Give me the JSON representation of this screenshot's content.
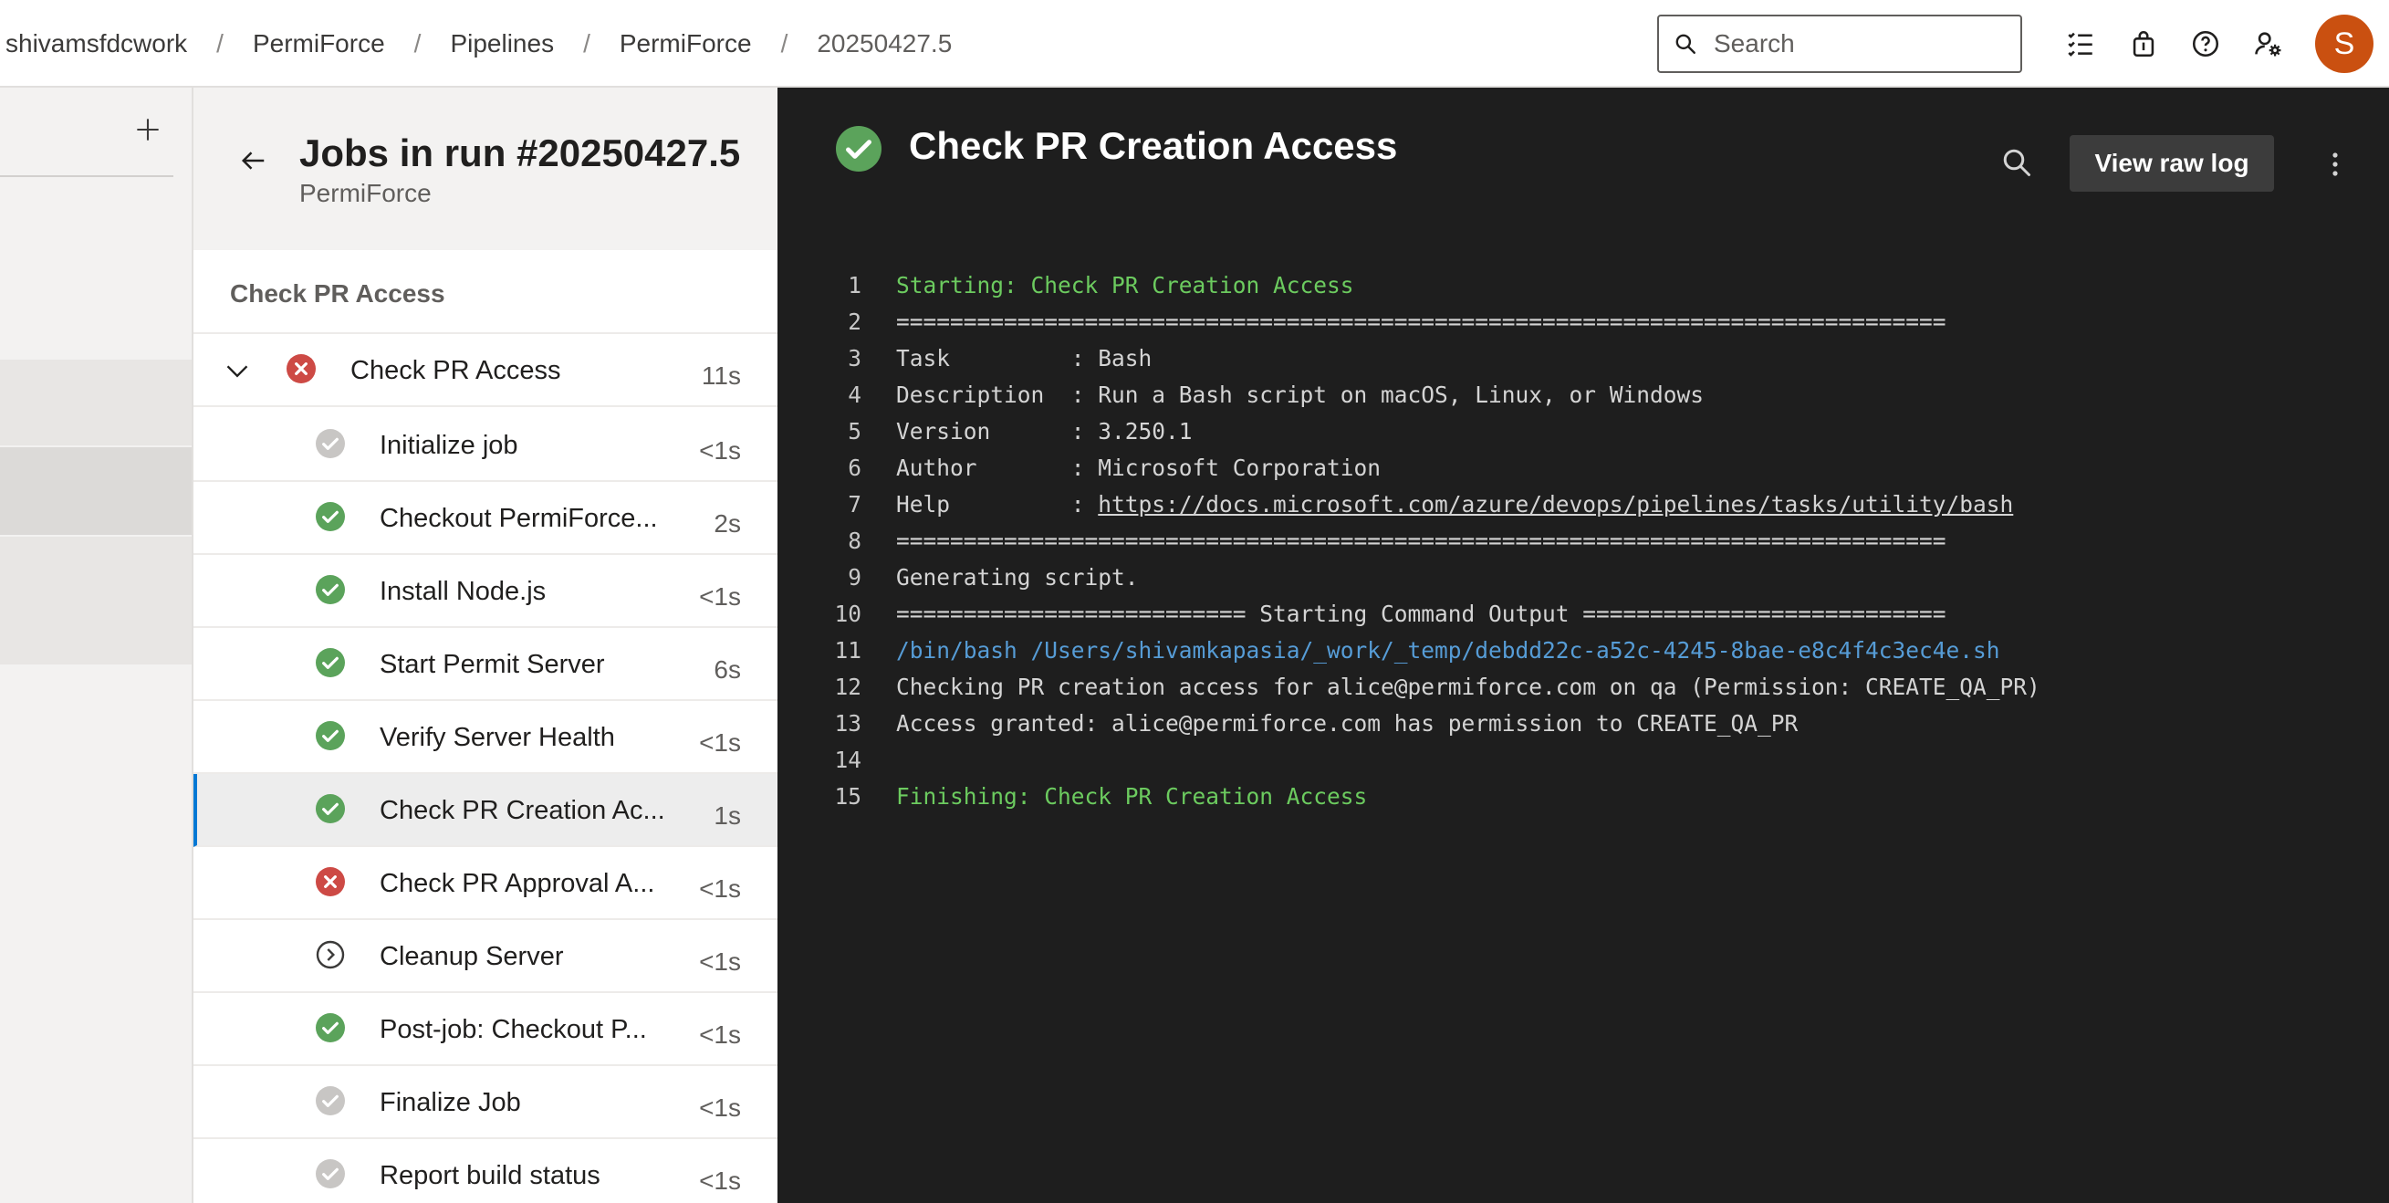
{
  "breadcrumb": [
    "shivamsfdcwork",
    "PermiForce",
    "Pipelines",
    "PermiForce",
    "20250427.5"
  ],
  "search": {
    "placeholder": "Search"
  },
  "user": {
    "initial": "S",
    "color": "#ca5010"
  },
  "colors": {
    "success": "#5ba35b",
    "failure": "#cd4a45",
    "skipped": "#c8c6c4",
    "accent": "#0078d4"
  },
  "jobs_panel": {
    "title": "Jobs in run #20250427.5",
    "subtitle": "PermiForce",
    "stage": "Check PR Access",
    "job": {
      "name": "Check PR Access",
      "duration": "11s",
      "status": "failed"
    },
    "steps": [
      {
        "name": "Initialize job",
        "duration": "<1s",
        "status": "skipped"
      },
      {
        "name": "Checkout PermiForce...",
        "duration": "2s",
        "status": "success"
      },
      {
        "name": "Install Node.js",
        "duration": "<1s",
        "status": "success"
      },
      {
        "name": "Start Permit Server",
        "duration": "6s",
        "status": "success"
      },
      {
        "name": "Verify Server Health",
        "duration": "<1s",
        "status": "success"
      },
      {
        "name": "Check PR Creation Ac...",
        "duration": "1s",
        "status": "success",
        "selected": true
      },
      {
        "name": "Check PR Approval A...",
        "duration": "<1s",
        "status": "failed"
      },
      {
        "name": "Cleanup Server",
        "duration": "<1s",
        "status": "pending"
      },
      {
        "name": "Post-job: Checkout P...",
        "duration": "<1s",
        "status": "success"
      },
      {
        "name": "Finalize Job",
        "duration": "<1s",
        "status": "skipped"
      },
      {
        "name": "Report build status",
        "duration": "<1s",
        "status": "skipped"
      }
    ]
  },
  "log": {
    "title": "Check PR Creation Access",
    "raw_button": "View raw log",
    "lines": [
      {
        "n": "1",
        "text": "Starting: Check PR Creation Access",
        "style": "green"
      },
      {
        "n": "2",
        "text": "==============================================================================",
        "style": "normal"
      },
      {
        "n": "3",
        "text": "Task         : Bash",
        "style": "normal"
      },
      {
        "n": "4",
        "text": "Description  : Run a Bash script on macOS, Linux, or Windows",
        "style": "normal"
      },
      {
        "n": "5",
        "text": "Version      : 3.250.1",
        "style": "normal"
      },
      {
        "n": "6",
        "text": "Author       : Microsoft Corporation",
        "style": "normal"
      },
      {
        "n": "7",
        "text": "Help         : ",
        "link": "https://docs.microsoft.com/azure/devops/pipelines/tasks/utility/bash",
        "style": "normal"
      },
      {
        "n": "8",
        "text": "==============================================================================",
        "style": "normal"
      },
      {
        "n": "9",
        "text": "Generating script.",
        "style": "normal"
      },
      {
        "n": "10",
        "text": "========================== Starting Command Output ===========================",
        "style": "normal"
      },
      {
        "n": "11",
        "text": "/bin/bash /Users/shivamkapasia/_work/_temp/debdd22c-a52c-4245-8bae-e8c4f4c3ec4e.sh",
        "style": "blue"
      },
      {
        "n": "12",
        "text": "Checking PR creation access for alice@permiforce.com on qa (Permission: CREATE_QA_PR)",
        "style": "normal"
      },
      {
        "n": "13",
        "text": "Access granted: alice@permiforce.com has permission to CREATE_QA_PR",
        "style": "normal"
      },
      {
        "n": "14",
        "text": "",
        "style": "normal"
      },
      {
        "n": "15",
        "text": "Finishing: Check PR Creation Access",
        "style": "green"
      }
    ]
  }
}
